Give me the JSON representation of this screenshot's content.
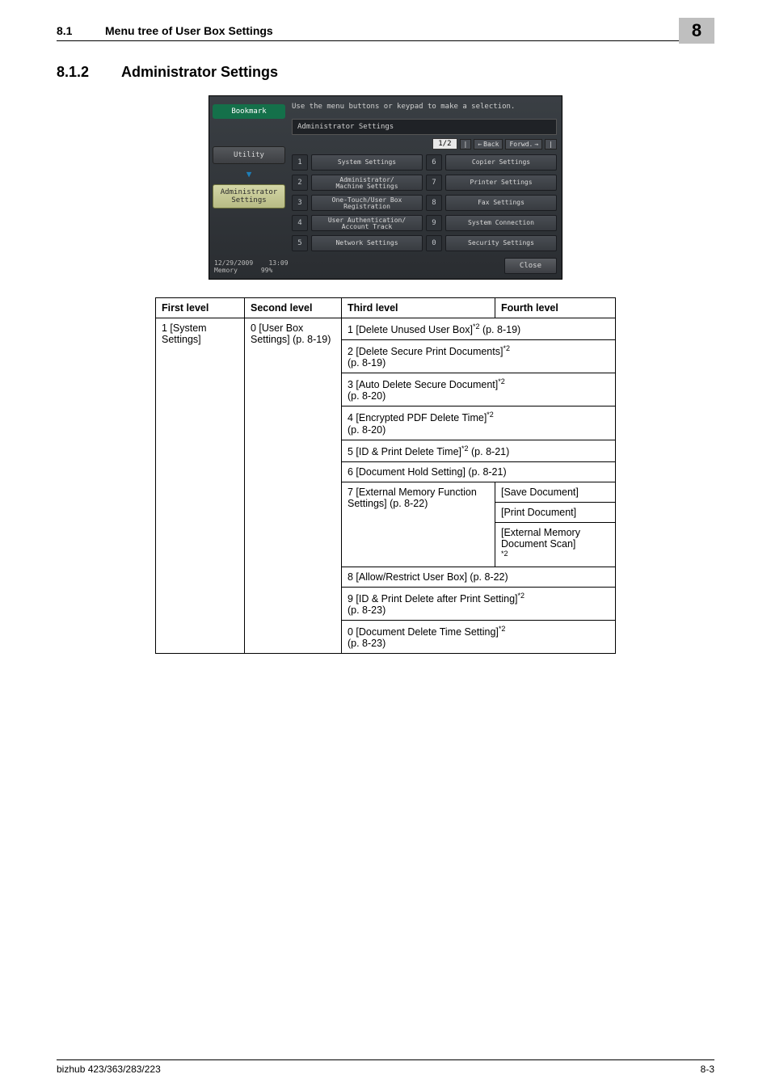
{
  "header": {
    "num": "8.1",
    "title": "Menu tree of User Box Settings",
    "chapter": "8"
  },
  "section": {
    "num": "8.1.2",
    "title": "Administrator Settings"
  },
  "shot": {
    "hint": "Use the menu buttons or keypad to make a selection.",
    "heading": "Administrator Settings",
    "page": "1/2",
    "back": "Back",
    "forward": "Forwd.",
    "left_tabs": {
      "bookmark": "Bookmark",
      "utility": "Utility",
      "admin1": "Administrator",
      "admin2": "Settings"
    },
    "options": {
      "n1": "1",
      "l1": "System Settings",
      "n2": "2",
      "l2a": "Administrator/",
      "l2b": "Machine Settings",
      "n3": "3",
      "l3a": "One-Touch/User Box",
      "l3b": "Registration",
      "n4": "4",
      "l4a": "User Authentication/",
      "l4b": "Account Track",
      "n5": "5",
      "l5": "Network Settings",
      "n6": "6",
      "l6": "Copier Settings",
      "n7": "7",
      "l7": "Printer Settings",
      "n8": "8",
      "l8": "Fax Settings",
      "n9": "9",
      "l9": "System Connection",
      "n0": "0",
      "l0": "Security Settings"
    },
    "footer": {
      "date": "12/29/2009",
      "time": "13:09",
      "memlabel": "Memory",
      "mem": "99%",
      "close": "Close"
    }
  },
  "table": {
    "headers": {
      "c1": "First level",
      "c2": "Second level",
      "c3": "Third level",
      "c4": "Fourth level"
    },
    "first": "1 [System Settings]",
    "second": "0 [User Box Settings] (p. 8-19)",
    "rows": {
      "r1": "1 [Delete Unused User Box]",
      "r1sup": "*2",
      "r1p": " (p. 8-19)",
      "r2": "2 [Delete Secure Print Documents]",
      "r2sup": "*2",
      "r2p": "(p. 8-19)",
      "r3": "3 [Auto Delete Secure Document]",
      "r3sup": "*2",
      "r3p": "(p. 8-20)",
      "r4": "4 [Encrypted PDF Delete Time]",
      "r4sup": "*2",
      "r4p": "(p. 8-20)",
      "r5": "5 [ID & Print Delete Time]",
      "r5sup": "*2",
      "r5p": " (p. 8-21)",
      "r6": "6 [Document Hold Setting] (p. 8-21)",
      "r7": "7 [External Memory Function Settings] (p. 8-22)",
      "r7a": "[Save Document]",
      "r7b": "[Print Document]",
      "r7c": "[External Memory Document Scan]",
      "r7csup": "*2",
      "r8": "8 [Allow/Restrict User Box] (p. 8-22)",
      "r9": "9 [ID & Print Delete after Print Setting]",
      "r9sup": "*2",
      "r9p": "(p. 8-23)",
      "r10": "0 [Document Delete Time Setting]",
      "r10sup": "*2",
      "r10p": "(p. 8-23)"
    }
  },
  "footer": {
    "left": "bizhub 423/363/283/223",
    "right": "8-3"
  }
}
